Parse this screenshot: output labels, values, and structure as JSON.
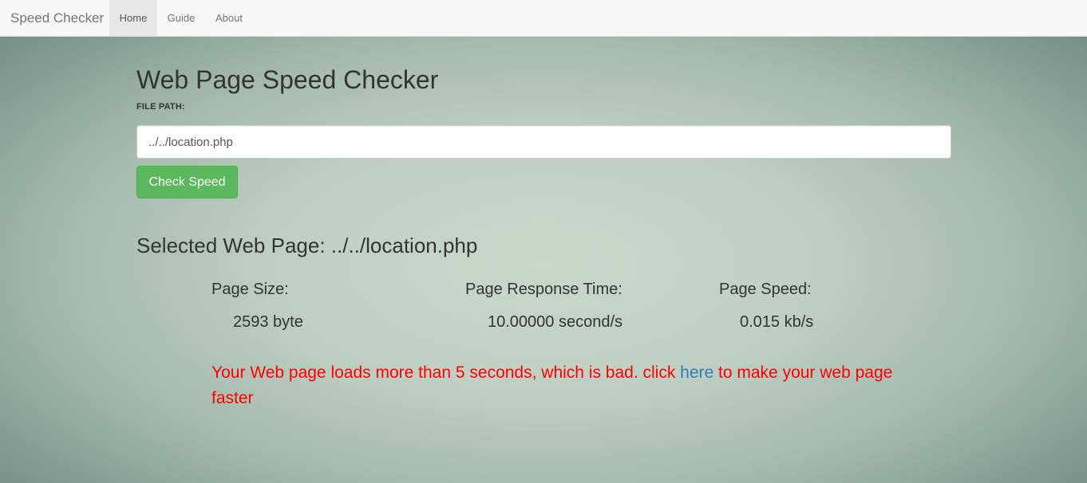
{
  "navbar": {
    "brand": "Speed Checker",
    "items": [
      {
        "label": "Home",
        "active": true
      },
      {
        "label": "Guide",
        "active": false
      },
      {
        "label": "About",
        "active": false
      }
    ]
  },
  "main": {
    "title": "Web Page Speed Checker",
    "file_path_label": "FILE PATH:",
    "file_path_value": "../../location.php",
    "check_button": "Check Speed",
    "selected_heading": "Selected Web Page: ../../location.php"
  },
  "stats": {
    "size_label": "Page Size:",
    "size_value": "2593 byte",
    "response_label": "Page Response Time:",
    "response_value": "10.00000 second/s",
    "speed_label": "Page Speed:",
    "speed_value": "0.015 kb/s"
  },
  "warning": {
    "before_link": "Your Web page loads more than 5 seconds, which is bad. click ",
    "link_text": "here",
    "after_link": " to make your web page faster"
  },
  "colors": {
    "warning": "#ff0000",
    "link": "#337ab7",
    "button": "#5cb85c"
  }
}
